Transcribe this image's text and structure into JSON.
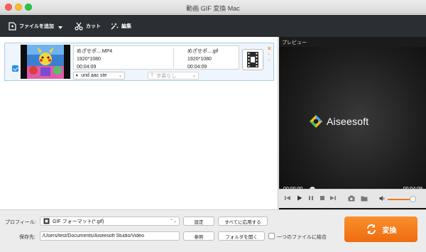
{
  "window": {
    "title": "動画 GIF 変換 Mac"
  },
  "toolbar": {
    "add_file_label": "ファイルを追加",
    "cut_label": "カット",
    "edit_label": "編集"
  },
  "file": {
    "checked": true,
    "source_name": "めざせポ....MP4",
    "source_resolution": "1920*1080",
    "source_duration": "00:04:09",
    "output_name": "めざせポ....gif",
    "output_resolution": "1920*1080",
    "output_duration": "00:04:09",
    "audio_track": "und aac ste",
    "subtitle": "字幕なし",
    "output_format_icon": "gif-film-icon"
  },
  "preview": {
    "label": "プレビュー",
    "brand": "Aiseesoft",
    "time_current": "00:00:00",
    "time_total": "00:04:09",
    "progress": 0,
    "volume": 0.85
  },
  "bottom": {
    "profile_label": "プロフィール:",
    "profile_value": "GIF フォーマット(*.gif)",
    "settings_label": "設定",
    "apply_all_label": "すべてに応用する",
    "dest_label": "保存先:",
    "dest_path": "/Users/test/Documents/Aiseesoft Studio/Video",
    "browse_label": "参照",
    "open_folder_label": "フォルダを開く",
    "merge_label": "一つのファイルに結合",
    "merge_checked": false,
    "convert_label": "変換"
  },
  "colors": {
    "accent": "#f07a14",
    "toolbar_bg": "#2b2e33",
    "selection_border": "#a9cdee",
    "check_blue": "#2a8be8"
  }
}
